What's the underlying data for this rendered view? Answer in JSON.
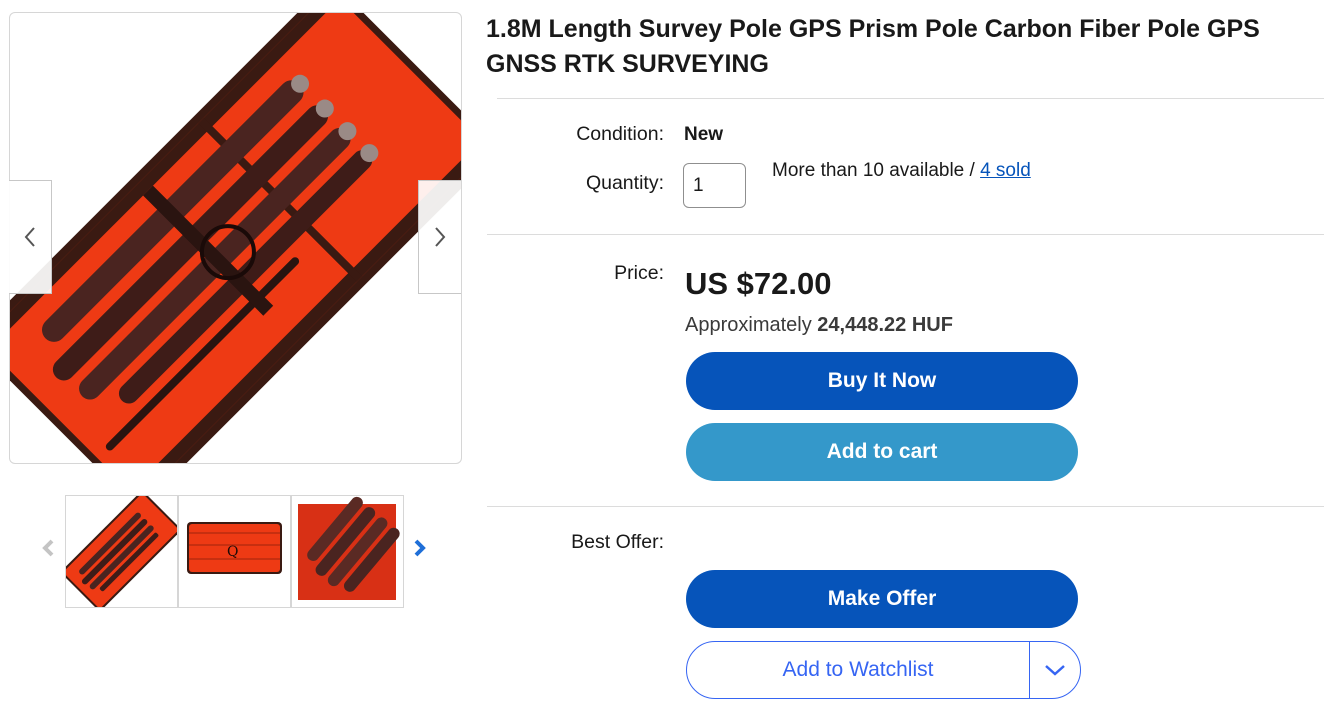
{
  "listing": {
    "title": "1.8M Length Survey Pole GPS Prism Pole Carbon Fiber Pole GPS GNSS RTK SURVEYING"
  },
  "gallery": {
    "prev_icon": "chevron-left-icon",
    "next_icon": "chevron-right-icon",
    "thumbnail_count": 3
  },
  "details": {
    "condition_label": "Condition:",
    "condition_value": "New",
    "quantity_label": "Quantity:",
    "quantity_value": "1",
    "availability_text": "More than 10 available / ",
    "sold_link": "4 sold"
  },
  "pricing": {
    "price_label": "Price:",
    "price": "US $72.00",
    "approx_prefix": "Approximately ",
    "approx_value": "24,448.22 HUF",
    "buy_now_label": "Buy It Now",
    "add_to_cart_label": "Add to cart"
  },
  "offer": {
    "best_offer_label": "Best Offer:",
    "make_offer_label": "Make Offer",
    "watchlist_label": "Add to Watchlist"
  },
  "colors": {
    "primary_button": "#0654ba",
    "cart_button": "#3498ca",
    "link": "#0654ba",
    "watchlist_outline": "#3665f3",
    "bag_orange": "#ee3a14"
  }
}
